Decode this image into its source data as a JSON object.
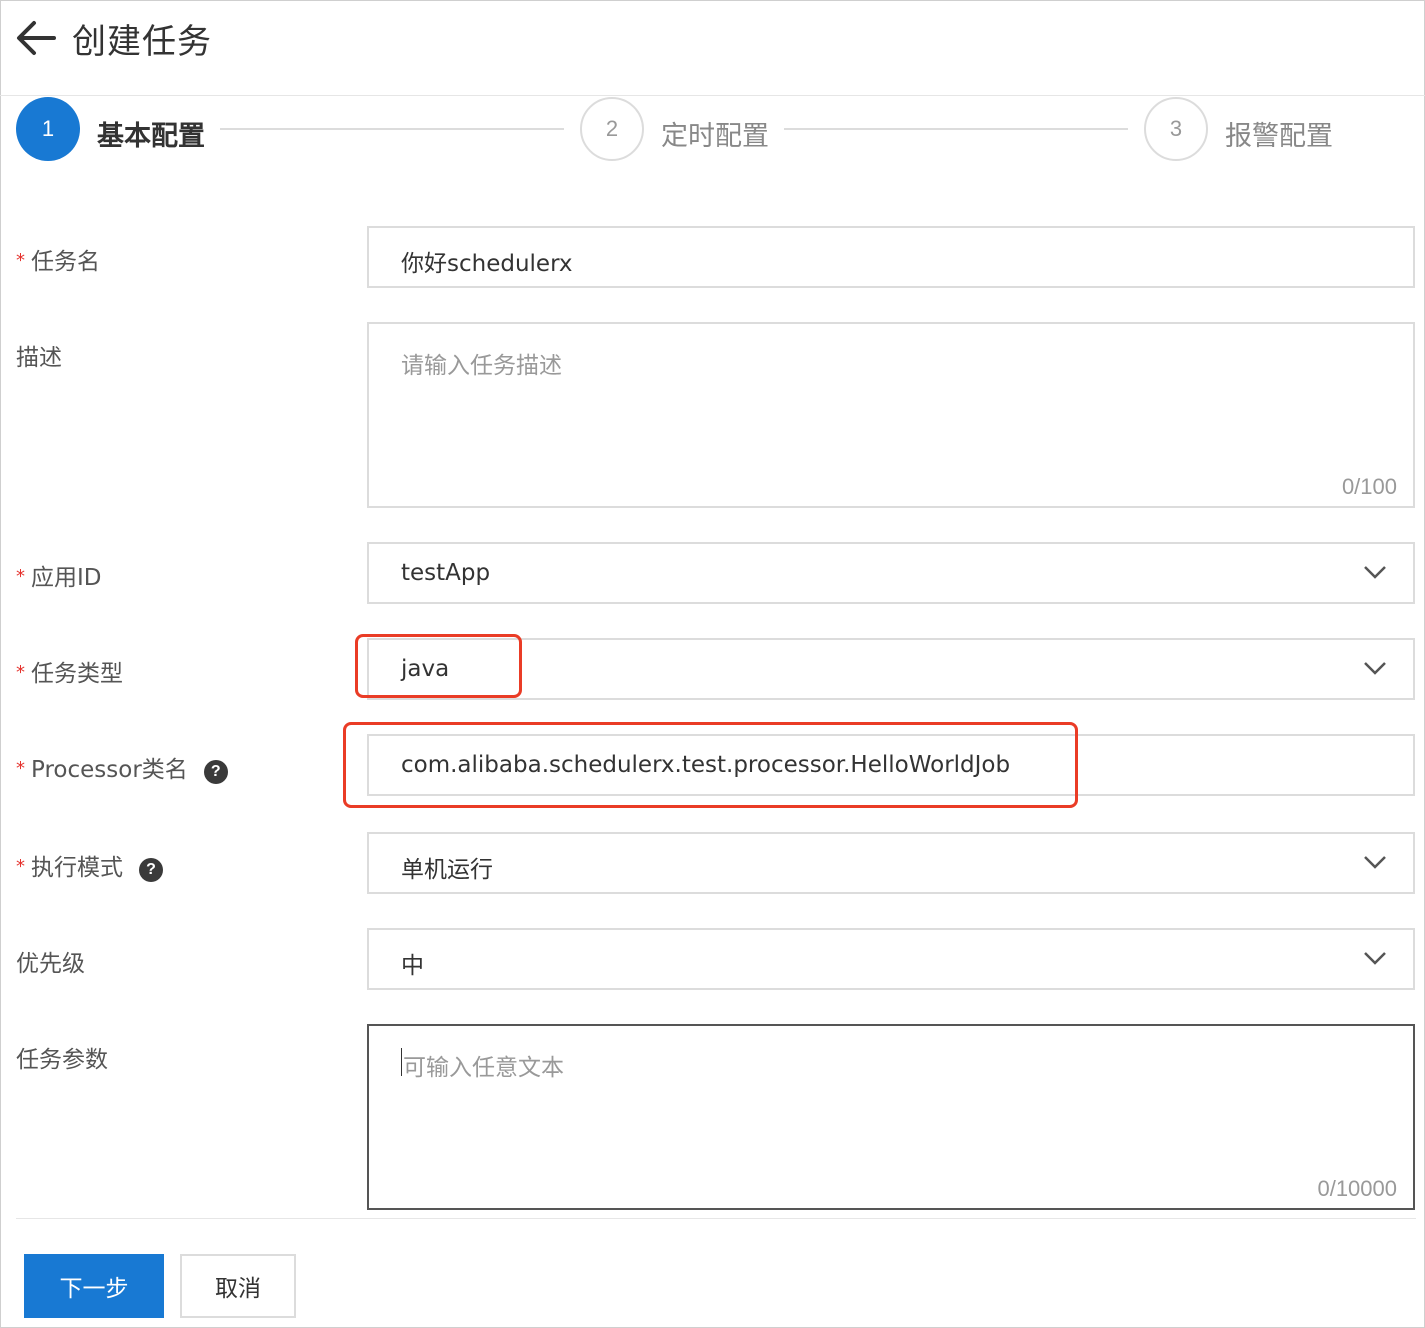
{
  "header": {
    "title": "创建任务",
    "back_icon": "arrow-left-icon"
  },
  "steps": [
    {
      "number": "1",
      "label": "基本配置",
      "state": "active"
    },
    {
      "number": "2",
      "label": "定时配置",
      "state": "pending"
    },
    {
      "number": "3",
      "label": "报警配置",
      "state": "pending"
    }
  ],
  "form": {
    "task_name": {
      "label": "任务名",
      "required": "*",
      "value": "你好schedulerx"
    },
    "description": {
      "label": "描述",
      "placeholder": "请输入任务描述",
      "counter": "0/100"
    },
    "app_id": {
      "label": "应用ID",
      "required": "*",
      "value": "testApp"
    },
    "task_type": {
      "label": "任务类型",
      "required": "*",
      "value": "java"
    },
    "processor": {
      "label": "Processor类名",
      "required": "*",
      "help": "?",
      "value": "com.alibaba.schedulerx.test.processor.HelloWorldJob"
    },
    "exec_mode": {
      "label": "执行模式",
      "required": "*",
      "help": "?",
      "value": "单机运行"
    },
    "priority": {
      "label": "优先级",
      "value": "中"
    },
    "params": {
      "label": "任务参数",
      "placeholder": "可输入任意文本",
      "counter": "0/10000"
    }
  },
  "buttons": {
    "next": "下一步",
    "cancel": "取消"
  },
  "colors": {
    "primary": "#1879d3",
    "required": "#e5322d",
    "highlight": "#ea3c26"
  }
}
